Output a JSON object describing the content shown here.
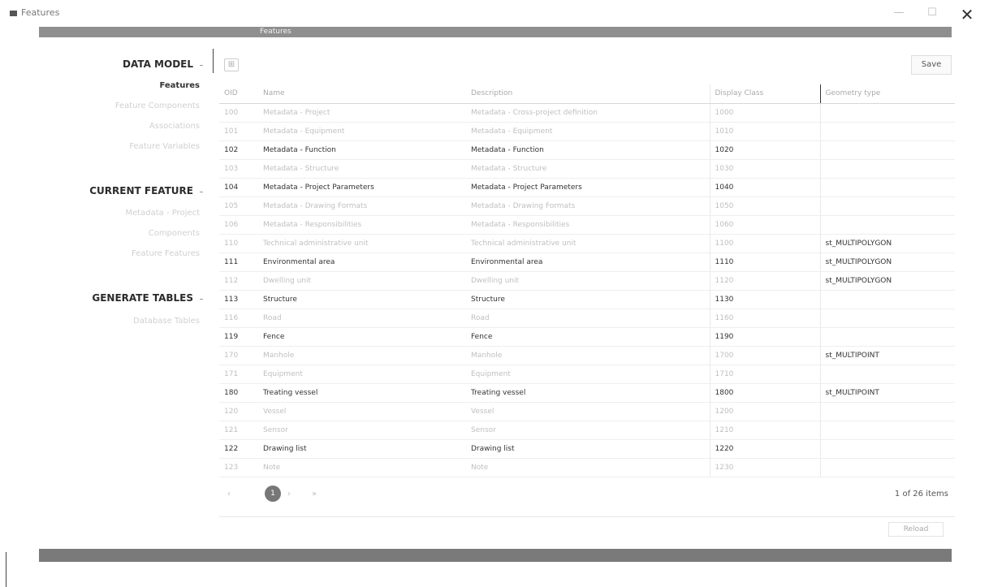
{
  "window": {
    "title": "Features",
    "min_glyph": "—",
    "max_glyph": "☐",
    "close_glyph": "✕"
  },
  "topband": {
    "label": "Features"
  },
  "sidebar": {
    "data_model": {
      "title": "DATA MODEL",
      "items": [
        {
          "label": "Features",
          "active": true
        },
        {
          "label": "Feature Components",
          "active": false
        },
        {
          "label": "Associations",
          "active": false
        },
        {
          "label": "Feature Variables",
          "active": false
        }
      ]
    },
    "current_feature": {
      "title": "CURRENT FEATURE",
      "items": [
        {
          "label": "Metadata - Project",
          "active": false
        },
        {
          "label": "Components",
          "active": false
        },
        {
          "label": "Feature Features",
          "active": false
        }
      ]
    },
    "generate_tables": {
      "title": "GENERATE TABLES",
      "items": [
        {
          "label": "Database Tables",
          "active": false
        }
      ]
    }
  },
  "toolbar": {
    "tool_icon": "filter-icon",
    "tool_glyph": "⊞",
    "save_label": "Save"
  },
  "table": {
    "columns": [
      "OID",
      "Name",
      "Description",
      "Display Class",
      "Geometry type"
    ],
    "rows": [
      {
        "id": "100",
        "name": "Metadata - Project",
        "desc": "Metadata - Cross-project definition",
        "disp": "1000",
        "geo": "",
        "bold": false
      },
      {
        "id": "101",
        "name": "Metadata - Equipment",
        "desc": "Metadata - Equipment",
        "disp": "1010",
        "geo": "",
        "bold": false
      },
      {
        "id": "102",
        "name": "Metadata - Function",
        "desc": "Metadata - Function",
        "disp": "1020",
        "geo": "",
        "bold": true
      },
      {
        "id": "103",
        "name": "Metadata - Structure",
        "desc": "Metadata - Structure",
        "disp": "1030",
        "geo": "",
        "bold": false
      },
      {
        "id": "104",
        "name": "Metadata - Project Parameters",
        "desc": "Metadata - Project Parameters",
        "disp": "1040",
        "geo": "",
        "bold": true
      },
      {
        "id": "105",
        "name": "Metadata - Drawing Formats",
        "desc": "Metadata - Drawing Formats",
        "disp": "1050",
        "geo": "",
        "bold": false
      },
      {
        "id": "106",
        "name": "Metadata - Responsibilities",
        "desc": "Metadata - Responsibilities",
        "disp": "1060",
        "geo": "",
        "bold": false
      },
      {
        "id": "110",
        "name": "Technical administrative unit",
        "desc": "Technical administrative unit",
        "disp": "1100",
        "geo": "st_MULTIPOLYGON",
        "bold": false
      },
      {
        "id": "111",
        "name": "Environmental area",
        "desc": "Environmental area",
        "disp": "1110",
        "geo": "st_MULTIPOLYGON",
        "bold": true
      },
      {
        "id": "112",
        "name": "Dwelling unit",
        "desc": "Dwelling unit",
        "disp": "1120",
        "geo": "st_MULTIPOLYGON",
        "bold": false
      },
      {
        "id": "113",
        "name": "Structure",
        "desc": "Structure",
        "disp": "1130",
        "geo": "",
        "bold": true
      },
      {
        "id": "116",
        "name": "Road",
        "desc": "Road",
        "disp": "1160",
        "geo": "",
        "bold": false
      },
      {
        "id": "119",
        "name": "Fence",
        "desc": "Fence",
        "disp": "1190",
        "geo": "",
        "bold": true
      },
      {
        "id": "170",
        "name": "Manhole",
        "desc": "Manhole",
        "disp": "1700",
        "geo": "st_MULTIPOINT",
        "bold": false
      },
      {
        "id": "171",
        "name": "Equipment",
        "desc": "Equipment",
        "disp": "1710",
        "geo": "",
        "bold": false
      },
      {
        "id": "180",
        "name": "Treating vessel",
        "desc": "Treating vessel",
        "disp": "1800",
        "geo": "st_MULTIPOINT",
        "bold": true
      },
      {
        "id": "120",
        "name": "Vessel",
        "desc": "Vessel",
        "disp": "1200",
        "geo": "",
        "bold": false
      },
      {
        "id": "121",
        "name": "Sensor",
        "desc": "Sensor",
        "disp": "1210",
        "geo": "",
        "bold": false
      },
      {
        "id": "122",
        "name": "Drawing list",
        "desc": "Drawing list",
        "disp": "1220",
        "geo": "",
        "bold": true
      },
      {
        "id": "123",
        "name": "Note",
        "desc": "Note",
        "disp": "1230",
        "geo": "",
        "bold": false
      }
    ]
  },
  "pager": {
    "prev": "‹",
    "page": "1",
    "next": "›",
    "last": "»",
    "count": "1 of 26 items"
  },
  "footer": {
    "reload_label": "Reload"
  }
}
